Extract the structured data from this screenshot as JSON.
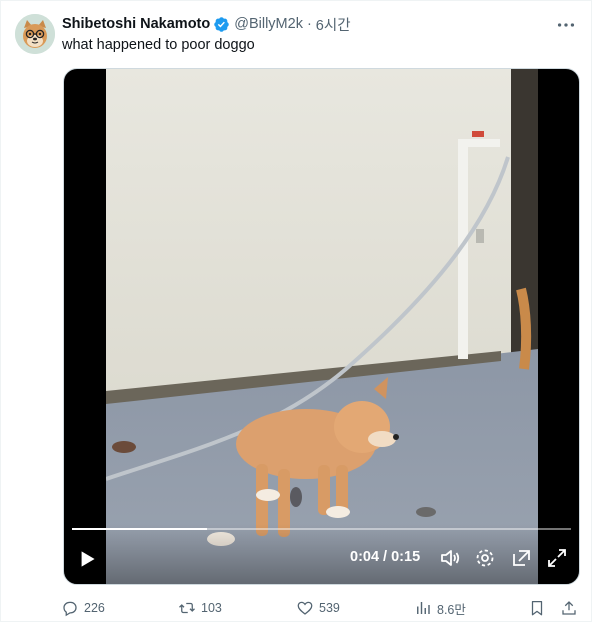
{
  "tweet": {
    "author_name": "Shibetoshi Nakamoto",
    "handle": "@BillyM2k",
    "separator": "·",
    "time": "6시간",
    "text": "what happened to poor doggo"
  },
  "video": {
    "time_readout": "0:04 / 0:15",
    "progress_fraction": 0.27
  },
  "actions": {
    "replies": "226",
    "retweets": "103",
    "likes": "539",
    "views": "8.6만"
  },
  "colors": {
    "verified": "#1d9bf0",
    "muted_text": "#536471",
    "primary_text": "#0f1419"
  },
  "icons": [
    "avatar-doge",
    "verified-badge-icon",
    "more-icon",
    "play-icon",
    "volume-icon",
    "settings-icon",
    "pip-icon",
    "fullscreen-icon",
    "reply-icon",
    "retweet-icon",
    "like-icon",
    "views-icon",
    "bookmark-icon",
    "share-icon"
  ]
}
